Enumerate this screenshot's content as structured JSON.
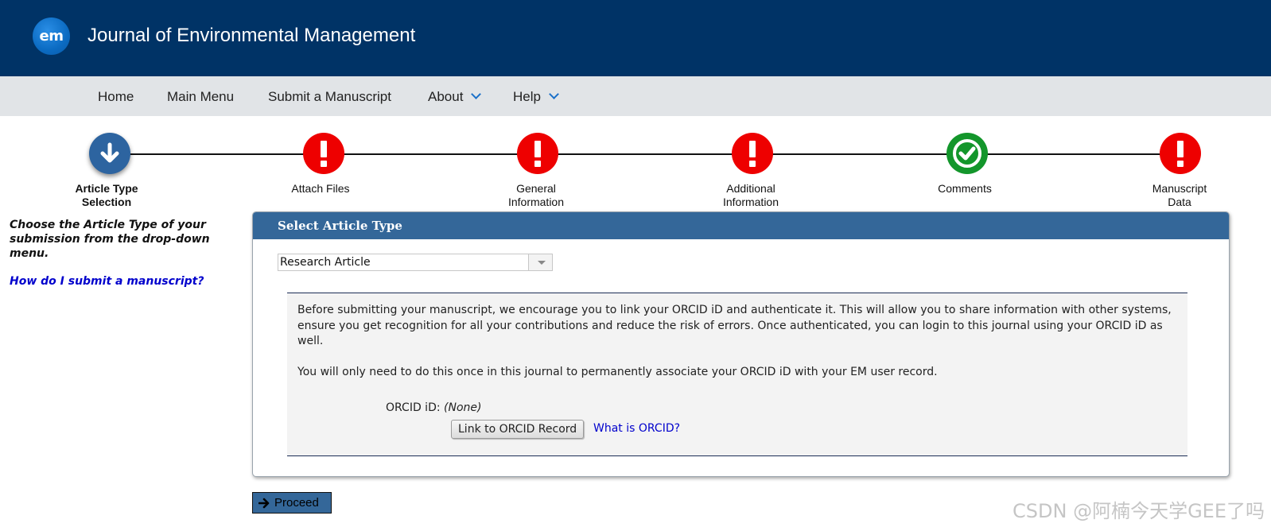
{
  "header": {
    "logo_text": "em",
    "journal_title": "Journal of Environmental Management",
    "background_color": "#003366"
  },
  "nav": {
    "items": [
      {
        "label": "Home"
      },
      {
        "label": "Main Menu"
      },
      {
        "label": "Submit a Manuscript"
      },
      {
        "label": "About",
        "dropdown": true
      },
      {
        "label": "Help",
        "dropdown": true
      }
    ]
  },
  "steps": [
    {
      "label_line1": "Article Type",
      "label_line2": "Selection",
      "status": "current",
      "icon": "arrow-down-icon"
    },
    {
      "label_line1": "Attach Files",
      "label_line2": "",
      "status": "error",
      "icon": "exclamation-icon"
    },
    {
      "label_line1": "General",
      "label_line2": "Information",
      "status": "error",
      "icon": "exclamation-icon"
    },
    {
      "label_line1": "Additional",
      "label_line2": "Information",
      "status": "error",
      "icon": "exclamation-icon"
    },
    {
      "label_line1": "Comments",
      "label_line2": "",
      "status": "complete",
      "icon": "checkmark-icon"
    },
    {
      "label_line1": "Manuscript",
      "label_line2": "Data",
      "status": "error",
      "icon": "exclamation-icon"
    }
  ],
  "sidebar": {
    "instruction": "Choose the Article Type of your submission from the drop-down menu.",
    "help_link": "How do I submit a manuscript?"
  },
  "panel": {
    "title": "Select Article Type",
    "article_type_selected": "Research Article",
    "orcid": {
      "paragraph1": "Before submitting your manuscript, we encourage you to link your ORCID iD and authenticate it. This will allow you to share information with other systems, ensure you get recognition for all your contributions and reduce the risk of errors. Once authenticated, you can login to this journal using your ORCID iD as well.",
      "paragraph2": "You will only need to do this once in this journal to permanently associate your ORCID iD with your EM user record.",
      "label": "ORCID iD:",
      "value": "(None)",
      "link_button": "Link to ORCID Record",
      "what_is_link": "What is ORCID?"
    }
  },
  "proceed_button": "Proceed",
  "watermark": "CSDN @阿楠今天学GEE了吗",
  "colors": {
    "accent_blue": "#346799",
    "error_red": "#ee0000",
    "success_green": "#13962b",
    "link_blue": "#0000cc"
  }
}
